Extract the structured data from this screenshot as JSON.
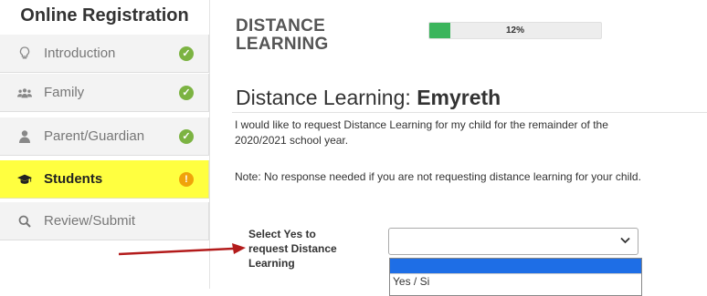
{
  "sidebar": {
    "title": "Online Registration",
    "items": [
      {
        "label": "Introduction",
        "icon": "lightbulb-icon",
        "status": "complete"
      },
      {
        "label": "Family",
        "icon": "family-icon",
        "status": "complete"
      },
      {
        "label": "Parent/Guardian",
        "icon": "person-icon",
        "status": "complete"
      },
      {
        "label": "Students",
        "icon": "graduation-cap-icon",
        "status": "warning"
      },
      {
        "label": "Review/Submit",
        "icon": "search-icon",
        "status": "none"
      }
    ]
  },
  "header": {
    "section_line1": "DISTANCE",
    "section_line2": "LEARNING",
    "progress_text": "12%",
    "progress_value": 0.12
  },
  "main": {
    "heading_prefix": "Distance Learning: ",
    "student_name": "Emyreth",
    "paragraph": "I would like to request Distance Learning for my child for the remainder of the 2020/2021 school year.",
    "note": "Note: No response needed if you are not requesting distance learning for your child.",
    "field_label": "Select Yes to request Distance Learning",
    "select_value": "",
    "options": [
      "",
      "Yes / Si"
    ]
  },
  "colors": {
    "active_highlight": "#ffff40",
    "complete": "#7cb342",
    "warning": "#f0a30a",
    "progress": "#3bb55c",
    "arrow": "#b31b1b",
    "option_highlight": "#1e6ee6"
  }
}
